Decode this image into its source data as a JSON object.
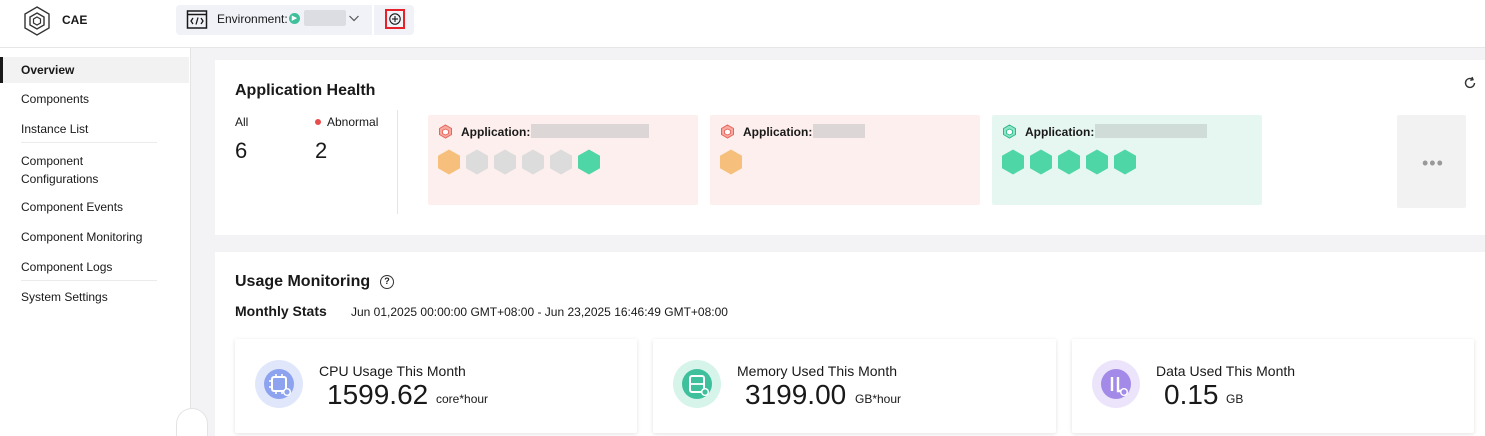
{
  "header": {
    "app_name": "CAE",
    "env_label": "Environment:",
    "env_value_visible": false
  },
  "sidebar": {
    "items": [
      {
        "label": "Overview",
        "active": true
      },
      {
        "label": "Components"
      },
      {
        "label": "Instance List"
      },
      {
        "label": "Component Configurations"
      },
      {
        "label": "Component Events"
      },
      {
        "label": "Component Monitoring"
      },
      {
        "label": "Component Logs"
      },
      {
        "label": "System Settings"
      }
    ]
  },
  "health": {
    "title": "Application Health",
    "all_label": "All",
    "all_count": "6",
    "abnormal_label": "Abnormal",
    "abnormal_count": "2",
    "apps": [
      {
        "label": "Application:",
        "status": "abnormal",
        "instances": [
          "warning",
          "stopped",
          "stopped",
          "stopped",
          "stopped",
          "healthy"
        ]
      },
      {
        "label": "Application:",
        "status": "abnormal",
        "instances": [
          "warning"
        ]
      },
      {
        "label": "Application:",
        "status": "healthy",
        "instances": [
          "healthy",
          "healthy",
          "healthy",
          "healthy",
          "healthy"
        ]
      }
    ],
    "more_label": "•••"
  },
  "usage": {
    "title": "Usage Monitoring",
    "help_glyph": "?",
    "period_label": "Monthly Stats",
    "period_range": "Jun 01,2025 00:00:00 GMT+08:00 - Jun 23,2025 16:46:49 GMT+08:00",
    "metrics": [
      {
        "label": "CPU Usage This Month",
        "value": "1599.62",
        "unit": "core*hour",
        "icon": "cpu-icon",
        "color": "#8ea3ef"
      },
      {
        "label": "Memory Used This Month",
        "value": "3199.00",
        "unit": "GB*hour",
        "icon": "memory-icon",
        "color": "#3fc09c"
      },
      {
        "label": "Data Used This Month",
        "value": "0.15",
        "unit": "GB",
        "icon": "data-icon",
        "color": "#a48ae8"
      }
    ]
  },
  "colors": {
    "warning_hex": "#f6c07c",
    "stopped_hex": "#dcdcdc",
    "healthy_hex": "#4fd6a7",
    "abnormal_dot": "#e84d4d"
  }
}
